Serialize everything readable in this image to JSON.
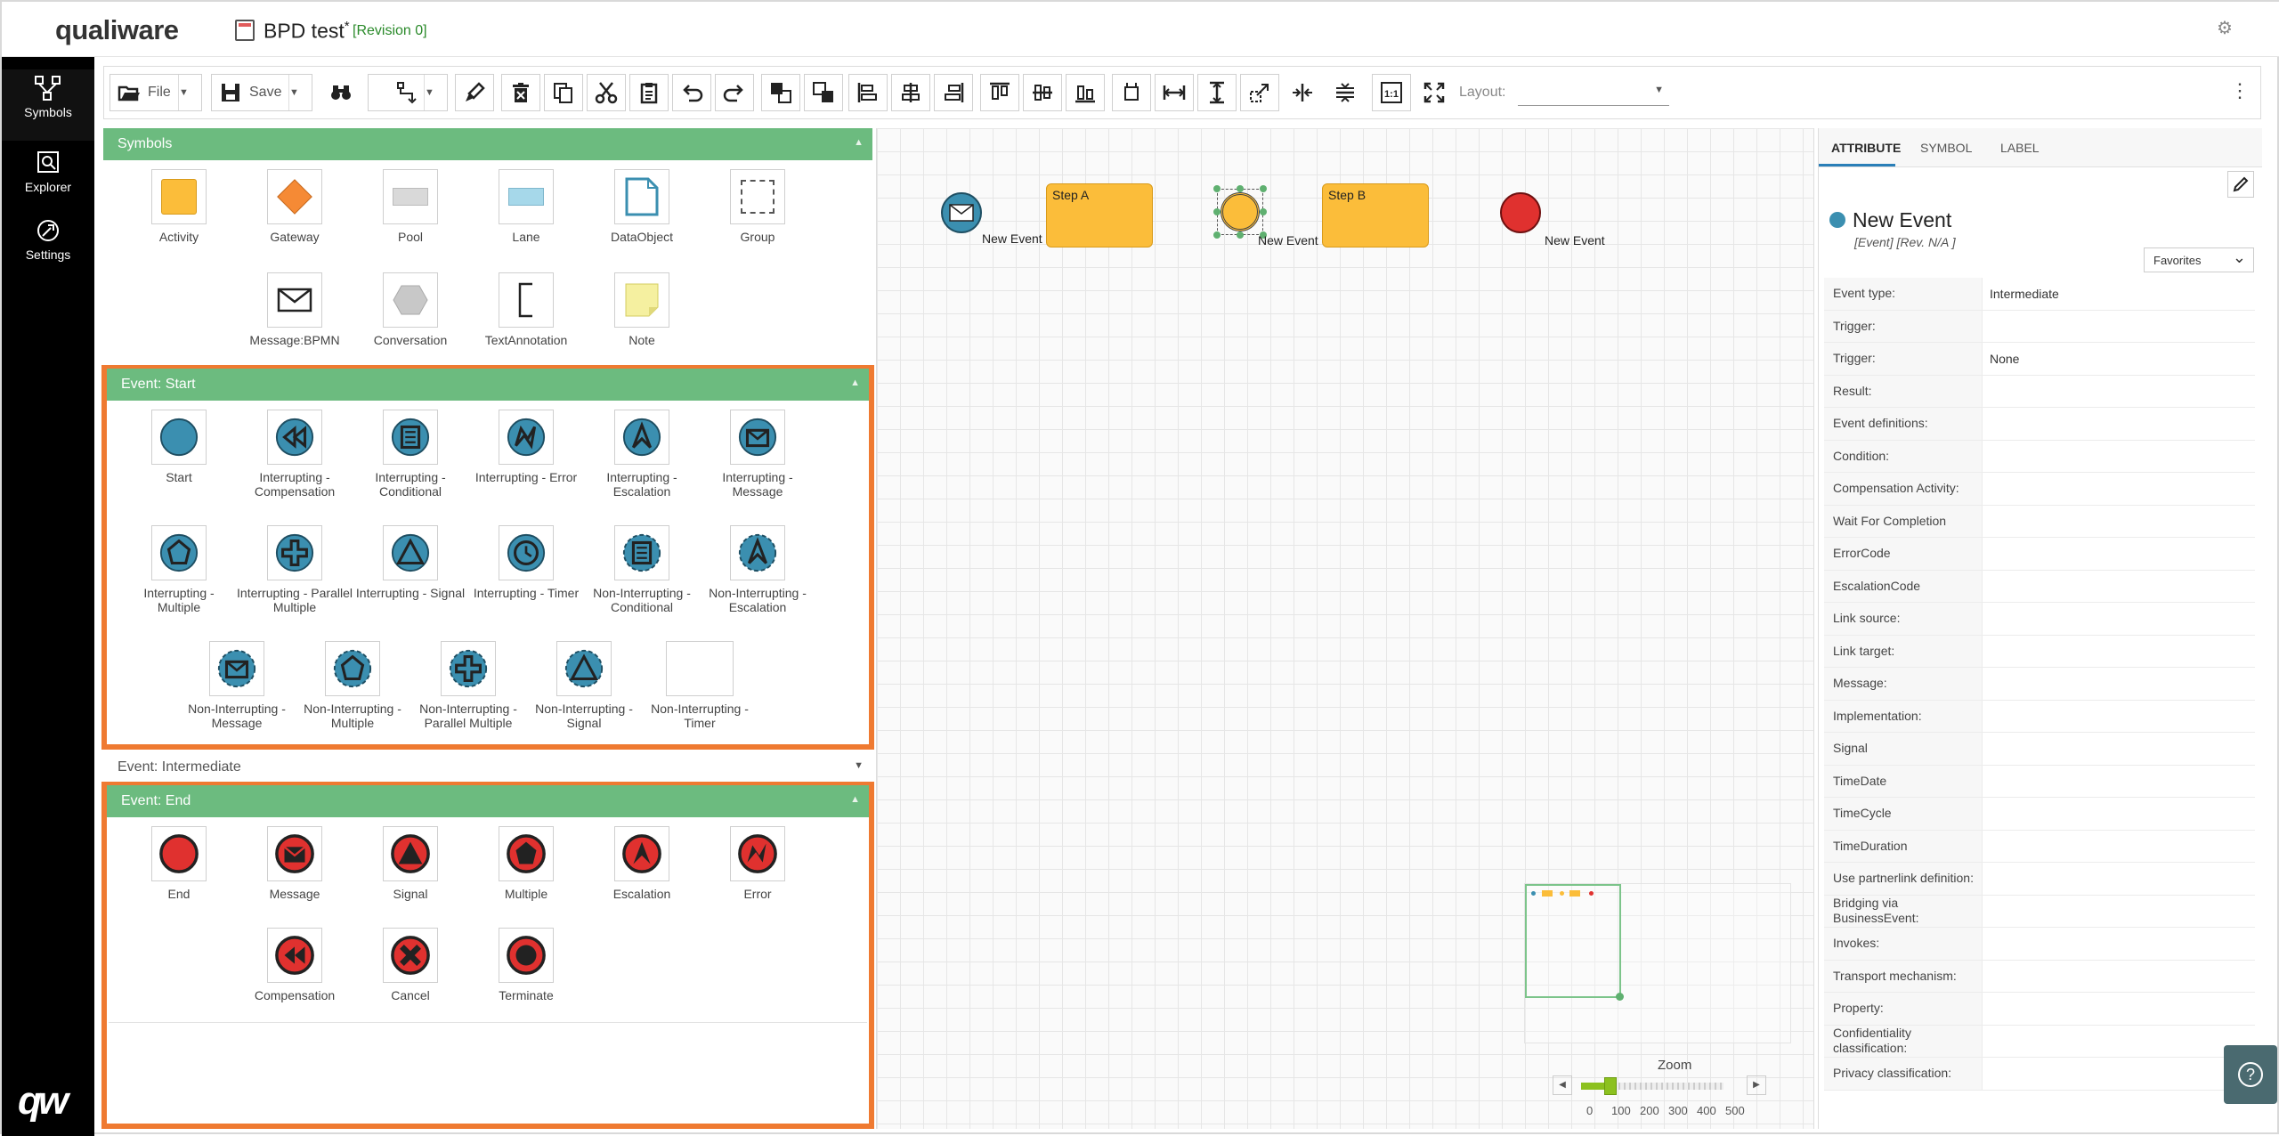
{
  "header": {
    "logo": "qualiware",
    "doc_title": "BPD test",
    "doc_modified": "*",
    "revision": "[Revision 0]"
  },
  "leftnav": {
    "items": [
      {
        "label": "Symbols",
        "icon": "symbols-icon"
      },
      {
        "label": "Explorer",
        "icon": "explorer-icon"
      },
      {
        "label": "Settings",
        "icon": "settings-icon"
      }
    ],
    "brand": "qw"
  },
  "toolbar": {
    "file_label": "File",
    "save_label": "Save",
    "layout_label": "Layout:",
    "layout_value": ""
  },
  "palette": {
    "symbols": {
      "title": "Symbols",
      "items": [
        "Activity",
        "Gateway",
        "Pool",
        "Lane",
        "DataObject",
        "Group",
        "Message:BPMN",
        "Conversation",
        "TextAnnotation",
        "Note"
      ]
    },
    "event_start": {
      "title": "Event: Start",
      "items": [
        "Start",
        "Interrupting - Compensation",
        "Interrupting - Conditional",
        "Interrupting - Error",
        "Interrupting - Escalation",
        "Interrupting - Message",
        "Interrupting - Multiple",
        "Interrupting - Parallel Multiple",
        "Interrupting - Signal",
        "Interrupting - Timer",
        "Non-Interrupting - Conditional",
        "Non-Interrupting - Escalation",
        "Non-Interrupting - Message",
        "Non-Interrupting - Multiple",
        "Non-Interrupting - Parallel Multiple",
        "Non-Interrupting - Signal",
        "Non-Interrupting - Timer"
      ]
    },
    "event_intermediate": {
      "title": "Event: Intermediate"
    },
    "event_end": {
      "title": "Event: End",
      "items": [
        "End",
        "Message",
        "Signal",
        "Multiple",
        "Escalation",
        "Error",
        "Compensation",
        "Cancel",
        "Terminate"
      ]
    }
  },
  "canvas": {
    "nodes": [
      {
        "label": "New Event"
      },
      {
        "label": "Step A"
      },
      {
        "label": "New Event"
      },
      {
        "label": "Step B"
      },
      {
        "label": "New Event"
      }
    ],
    "zoom": {
      "label": "Zoom",
      "ticks": [
        "0",
        "100",
        "200",
        "300",
        "400",
        "500"
      ],
      "level": 100
    }
  },
  "properties": {
    "tabs": [
      "ATTRIBUTE",
      "SYMBOL",
      "LABEL"
    ],
    "title": "New Event",
    "subtitle": "[Event] [Rev. N/A ]",
    "favorites": "Favorites",
    "rows": [
      {
        "key": "Event type:",
        "value": "Intermediate"
      },
      {
        "key": "Trigger:",
        "value": ""
      },
      {
        "key": "Trigger:",
        "value": "None"
      },
      {
        "key": "Result:",
        "value": ""
      },
      {
        "key": "Event definitions:",
        "value": ""
      },
      {
        "key": "Condition:",
        "value": ""
      },
      {
        "key": "Compensation Activity:",
        "value": ""
      },
      {
        "key": "Wait For Completion",
        "value": ""
      },
      {
        "key": "ErrorCode",
        "value": ""
      },
      {
        "key": "EscalationCode",
        "value": ""
      },
      {
        "key": "Link source:",
        "value": ""
      },
      {
        "key": "Link target:",
        "value": ""
      },
      {
        "key": "Message:",
        "value": ""
      },
      {
        "key": "Implementation:",
        "value": ""
      },
      {
        "key": "Signal",
        "value": ""
      },
      {
        "key": "TimeDate",
        "value": ""
      },
      {
        "key": "TimeCycle",
        "value": ""
      },
      {
        "key": "TimeDuration",
        "value": ""
      },
      {
        "key": "Use partnerlink definition:",
        "value": ""
      },
      {
        "key": "Bridging via BusinessEvent:",
        "value": ""
      },
      {
        "key": "Invokes:",
        "value": ""
      },
      {
        "key": "Transport mechanism:",
        "value": ""
      },
      {
        "key": "Property:",
        "value": ""
      },
      {
        "key": "Confidentiality classification:",
        "value": ""
      },
      {
        "key": "Privacy classification:",
        "value": ""
      }
    ]
  },
  "colors": {
    "section_header": "#6cbb7f",
    "highlight": "#ef7a31",
    "event_blue": "#3b8fb0",
    "event_red": "#e0312f",
    "task_yellow": "#fbbd3a"
  }
}
